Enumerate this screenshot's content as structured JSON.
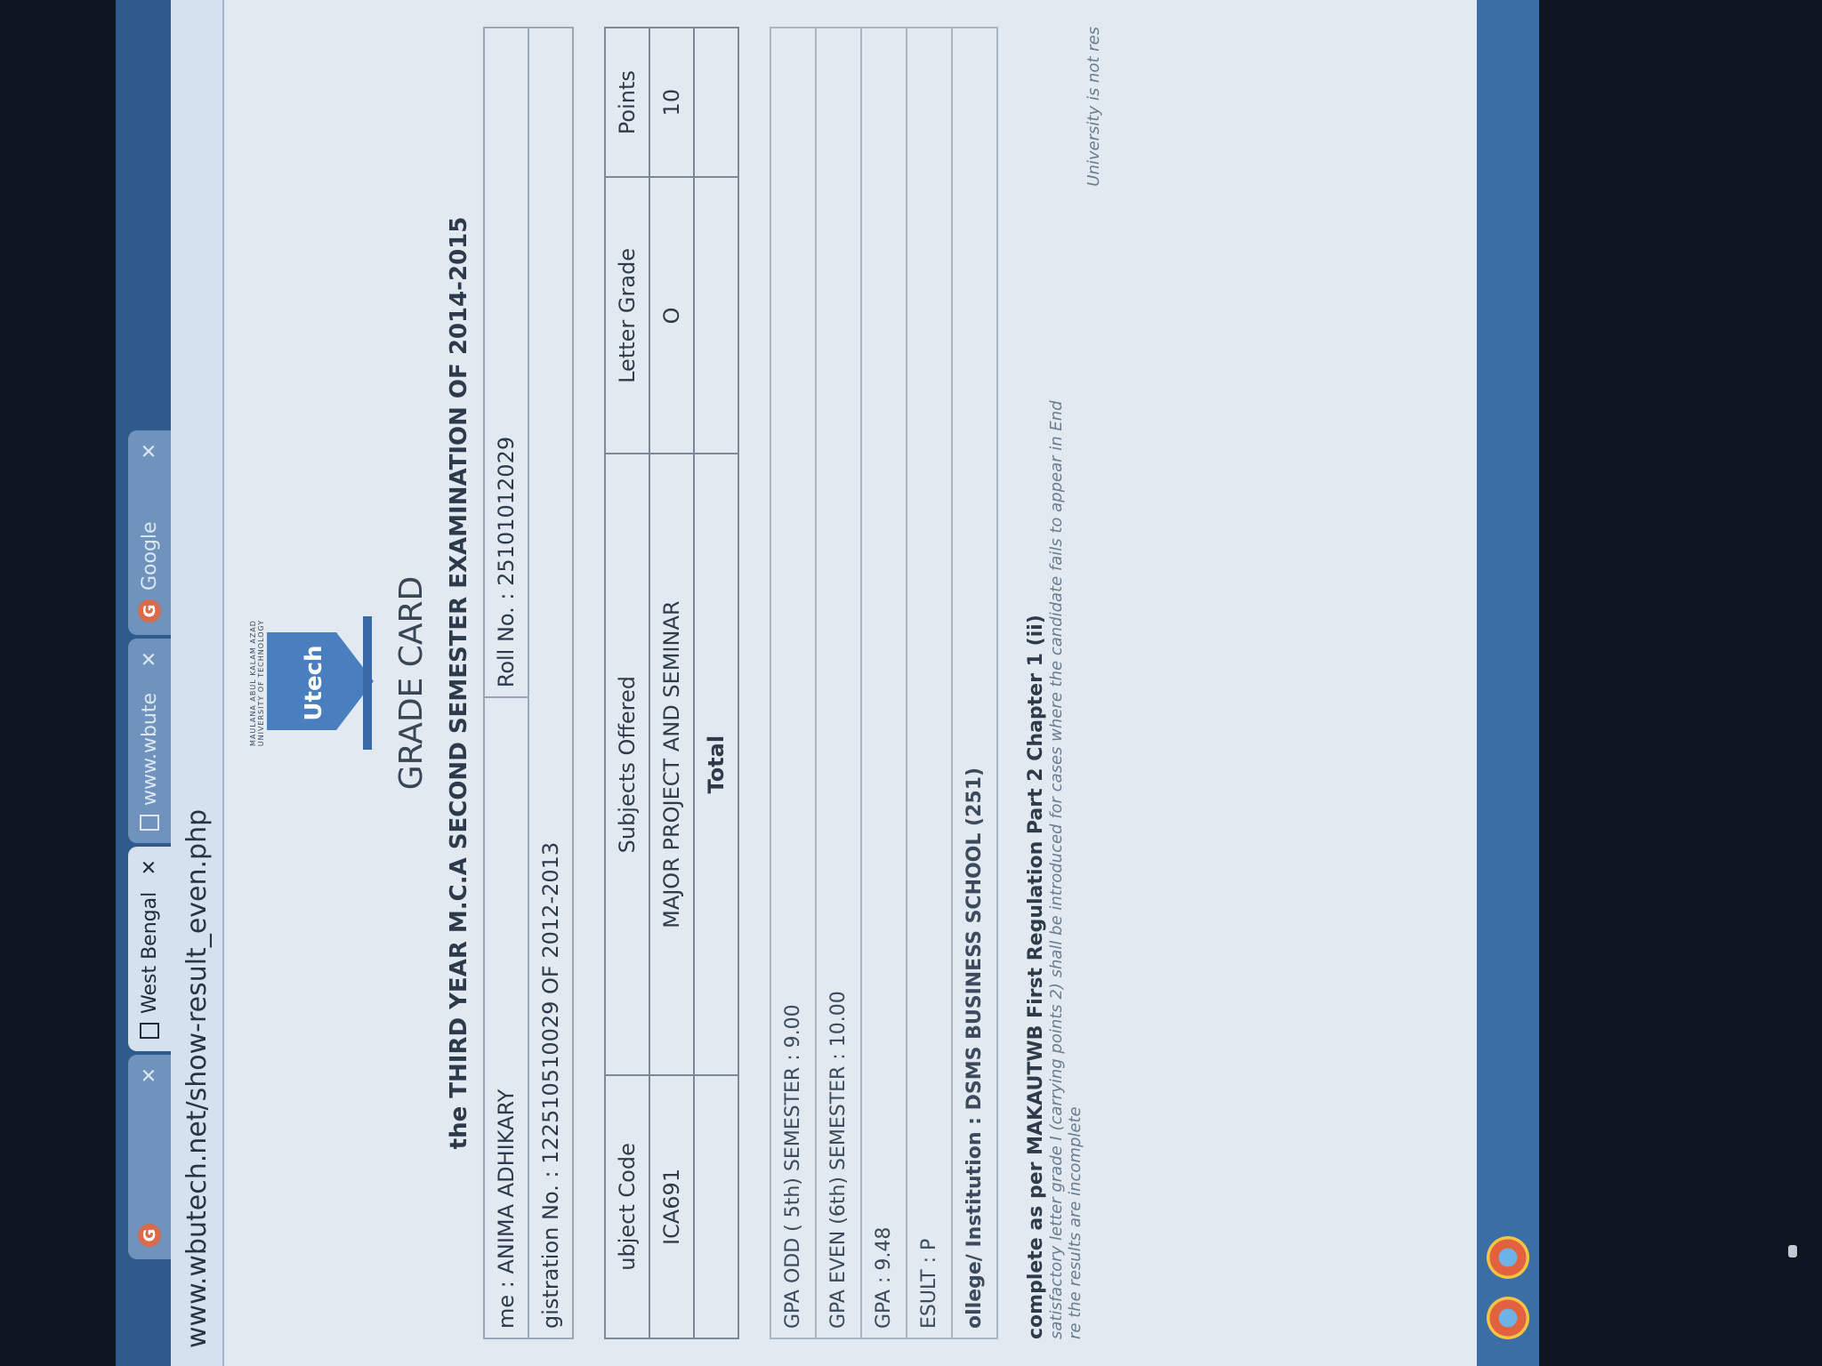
{
  "browser": {
    "tabs": [
      {
        "label": "",
        "icon": "google-icon",
        "active": false
      },
      {
        "label": "West Bengal",
        "icon": "document-icon",
        "active": true
      },
      {
        "label": "www.wbute",
        "icon": "document-icon",
        "active": false
      },
      {
        "label": "Google",
        "icon": "google-icon",
        "active": false
      }
    ],
    "url": "www.wbutech.net/show-result_even.php",
    "close_glyph": "✕"
  },
  "gradecard": {
    "logo_text": "Utech",
    "title": "GRADE CARD",
    "exam_title": "the THIRD YEAR M.C.A SECOND SEMESTER EXAMINATION OF 2014-2015",
    "name": "me : ANIMA ADHIKARY",
    "roll_no": "Roll No. : 25101012029",
    "registration": "gistration No. : 122510510029 OF 2012-2013",
    "columns": {
      "code": "ubject Code",
      "subject": "Subjects Offered",
      "grade": "Letter Grade",
      "points": "Points"
    },
    "rows": [
      {
        "code": "ICA691",
        "subject": "MAJOR PROJECT AND SEMINAR",
        "grade": "O",
        "points": "10"
      }
    ],
    "total_label": "Total",
    "summary": {
      "sgpa_odd": "GPA ODD ( 5th) SEMESTER : 9.00",
      "sgpa_even": "GPA EVEN (6th) SEMESTER : 10.00",
      "cgpa": "GPA : 9.48",
      "result": "ESULT : P",
      "college": "ollege/ Institution : DSMS BUSINESS SCHOOL (251)"
    },
    "footer_bold": "complete as per MAKAUTWB First Regulation Part 2 Chapter 1 (ii)",
    "footer_note": "satisfactory letter grade I (carrying points 2) shall be introduced for cases where the candidate fails to appear in End",
    "footer_note2": "re the results are incomplete",
    "bottom_right": "University is not res"
  }
}
